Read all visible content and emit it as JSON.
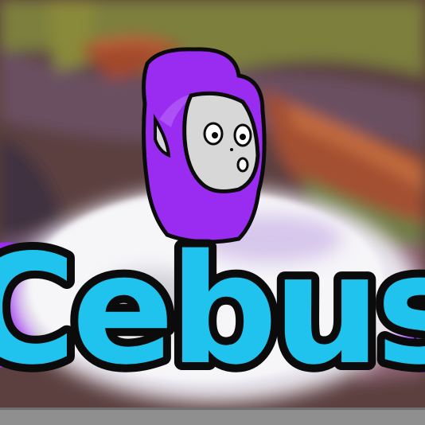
{
  "game_art": {
    "title": "Cebus",
    "character_icon": "purple-monkey-character",
    "colors": {
      "character_purple": "#9a2cf2",
      "title_cyan": "#1fc3ee",
      "outline": "#0b0b0b",
      "face_gray": "#d7d7d7",
      "cloud_white": "#f2f2f4",
      "bottom_bar": "#8f8f8f"
    }
  }
}
